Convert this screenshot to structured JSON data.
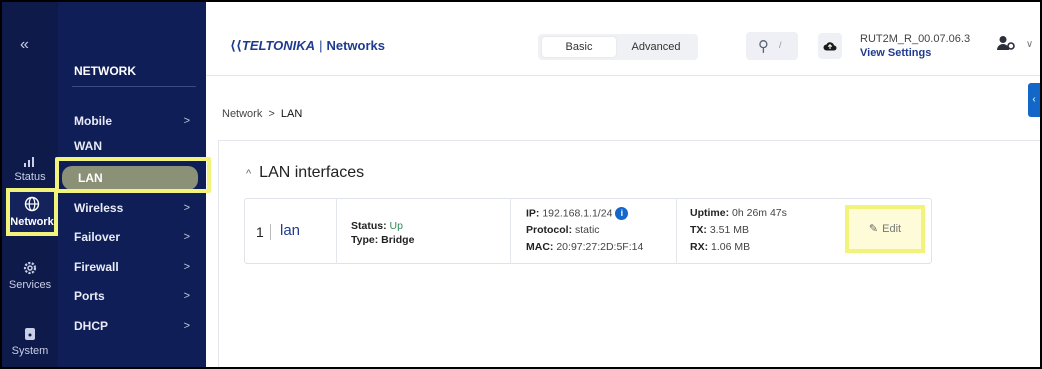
{
  "rail": {
    "collapse": "«",
    "items": [
      {
        "label": "Status",
        "icon": "signal-icon"
      },
      {
        "label": "Network",
        "icon": "globe-icon"
      },
      {
        "label": "Services",
        "icon": "gear-icon"
      },
      {
        "label": "System",
        "icon": "system-icon"
      }
    ]
  },
  "nav": {
    "title": "NETWORK",
    "items": [
      {
        "label": "Mobile",
        "chevron": ">"
      },
      {
        "label": "WAN",
        "chevron": ""
      },
      {
        "label": "LAN",
        "chevron": ""
      },
      {
        "label": "Wireless",
        "chevron": ">"
      },
      {
        "label": "Failover",
        "chevron": ">"
      },
      {
        "label": "Firewall",
        "chevron": ">"
      },
      {
        "label": "Ports",
        "chevron": ">"
      },
      {
        "label": "DHCP",
        "chevron": ">"
      }
    ]
  },
  "header": {
    "logo_brand": "TELTONIKA",
    "logo_sep": "|",
    "logo_sub": "Networks",
    "mode_basic": "Basic",
    "mode_advanced": "Advanced",
    "search_shortcut": "/",
    "firmware": "RUT2M_R_00.07.06.3",
    "view_settings": "View Settings"
  },
  "breadcrumb": {
    "root": "Network",
    "sep": ">",
    "current": "LAN"
  },
  "card": {
    "title": "LAN interfaces",
    "row": {
      "index": "1",
      "name": "lan",
      "status_label": "Status:",
      "status_value": "Up",
      "type_label": "Type:",
      "type_value": "Bridge",
      "ip_label": "IP:",
      "ip_value": "192.168.1.1/24",
      "protocol_label": "Protocol:",
      "protocol_value": "static",
      "mac_label": "MAC:",
      "mac_value": "20:97:27:2D:5F:14",
      "uptime_label": "Uptime:",
      "uptime_value": "0h 26m 47s",
      "tx_label": "TX:",
      "tx_value": "3.51 MB",
      "rx_label": "RX:",
      "rx_value": "1.06 MB",
      "edit_label": "Edit"
    }
  },
  "colors": {
    "rail_bg": "#0e1a4a",
    "nav_bg": "#0f1e56",
    "accent": "#1f3b8f",
    "highlight": "#f2f37a",
    "status_up": "#2e8b57"
  }
}
